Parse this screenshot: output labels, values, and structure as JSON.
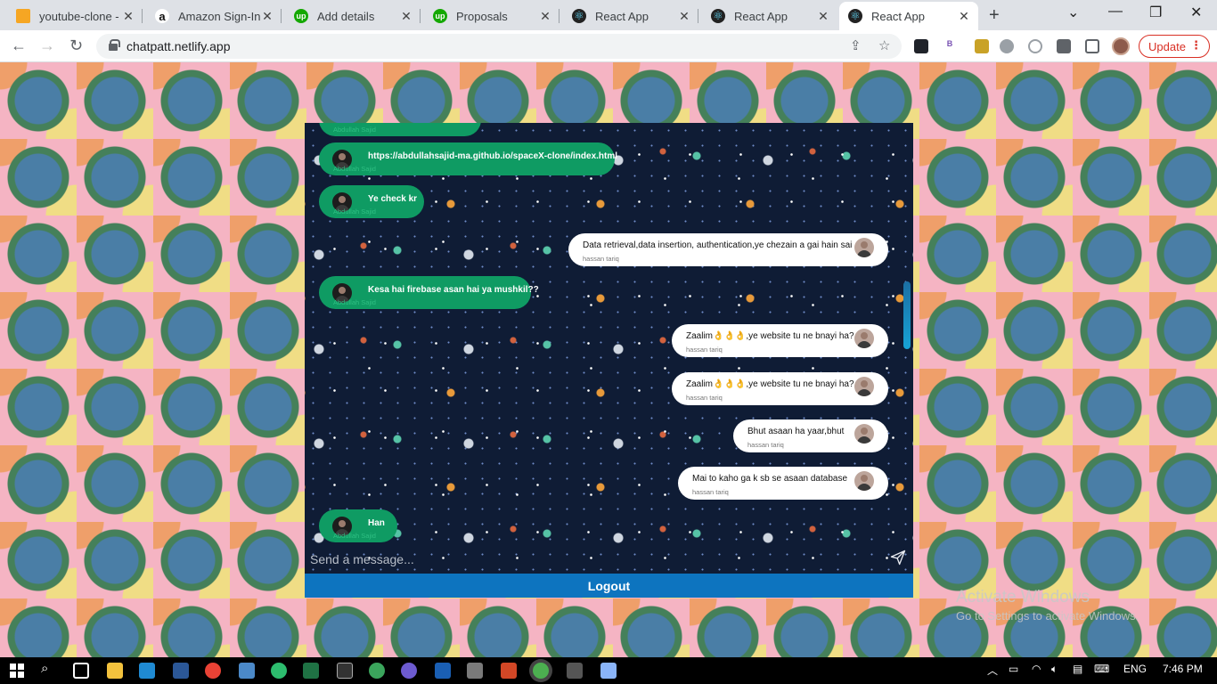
{
  "browser": {
    "tabs": [
      {
        "title": "youtube-clone - G",
        "color": "#f6a623",
        "glyph": ""
      },
      {
        "title": "Amazon Sign-In",
        "color": "#111111",
        "glyph": "a"
      },
      {
        "title": "Add details",
        "color": "#14a800",
        "glyph": "up"
      },
      {
        "title": "Proposals",
        "color": "#14a800",
        "glyph": "up"
      },
      {
        "title": "React App",
        "color": "#222222",
        "glyph": "⚛"
      },
      {
        "title": "React App",
        "color": "#222222",
        "glyph": "⚛"
      },
      {
        "title": "React App",
        "color": "#222222",
        "glyph": "⚛"
      }
    ],
    "url": "chatpatt.netlify.app",
    "update_label": "Update"
  },
  "chat": {
    "messages": [
      {
        "type": "recv",
        "text": "https://abdullahsajid-ma.github.io/spaceX-clone/index.html",
        "name": "Abdullah Sajid"
      },
      {
        "type": "recv",
        "text": "Ye check kr",
        "name": "Abdullah Sajid"
      },
      {
        "type": "sent",
        "text": "Data retrieval,data insertion, authentication,ye chezain a gai hain sai",
        "name": "hassan tariq"
      },
      {
        "type": "recv",
        "text": "Kesa hai firebase asan hai ya mushkil??",
        "name": "Abdullah Sajid"
      },
      {
        "type": "sent",
        "text": "Zaalim👌👌👌,ye website tu ne bnayi ha?",
        "name": "hassan tariq"
      },
      {
        "type": "sent",
        "text": "Zaalim👌👌👌,ye website tu ne bnayi ha?",
        "name": "hassan tariq"
      },
      {
        "type": "sent",
        "text": "Bhut asaan ha yaar,bhut",
        "name": "hassan tariq"
      },
      {
        "type": "sent",
        "text": "Mai to kaho ga k sb se asaan database",
        "name": "hassan tariq"
      },
      {
        "type": "recv",
        "text": "Han",
        "name": "Abdullah Sajid"
      }
    ],
    "partial_name": "Abdullah Sajid",
    "input_placeholder": "Send a message...",
    "logout_label": "Logout"
  },
  "watermark": {
    "line1": "Activate Windows",
    "line2": "Go to Settings to activate Windows."
  },
  "taskbar": {
    "language": "ENG",
    "time": "7:46 PM"
  }
}
